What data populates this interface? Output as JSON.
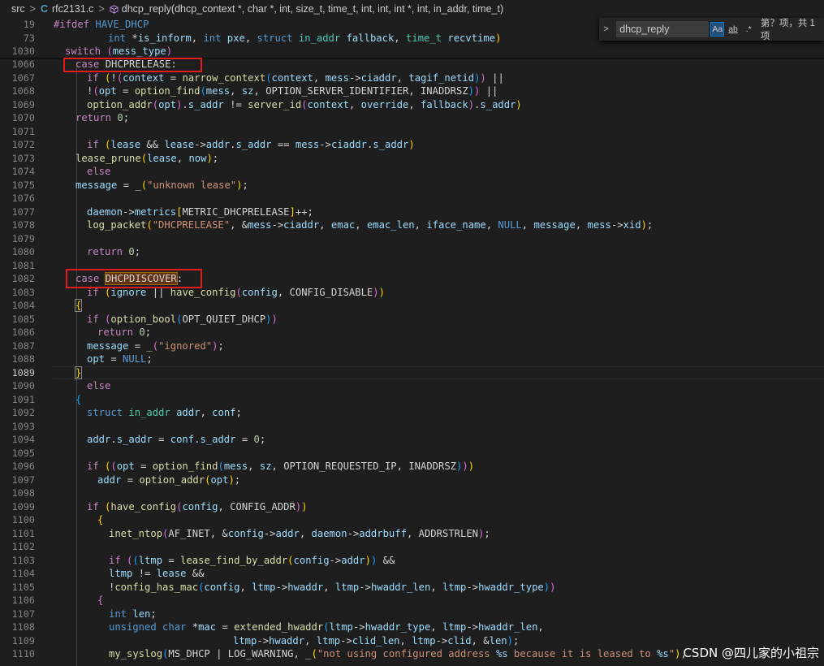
{
  "breadcrumb": {
    "folder": "src",
    "file_icon": "c-file-icon",
    "file_icon_text": "C",
    "file": "rfc2131.c",
    "symbol_icon": "method-icon",
    "symbol": "dhcp_reply(dhcp_context *, char *, int, size_t, time_t, int, int, int *, int, in_addr, time_t)"
  },
  "find": {
    "toggle_icon": "chevron-right-icon",
    "query": "dhcp_reply",
    "match_case": "Aa",
    "match_word": "ab",
    "regex": ".*",
    "result": "第？项，共 1 项"
  },
  "sticky_lines": [
    {
      "n": "19",
      "code": "#ifdef HAVE_DHCP"
    },
    {
      "n": "73",
      "code": "int *is_inform, int pxe, struct in_addr fallback, time_t recvtime)"
    },
    {
      "n": "1030",
      "code": "switch (mess_type)"
    }
  ],
  "lines": [
    {
      "n": "1066",
      "code": "case DHCPRELEASE:"
    },
    {
      "n": "1067",
      "code": "if (!(context = narrow_context(context, mess->ciaddr, tagif_netid)) ||"
    },
    {
      "n": "1068",
      "code": "!(opt = option_find(mess, sz, OPTION_SERVER_IDENTIFIER, INADDRSZ)) ||"
    },
    {
      "n": "1069",
      "code": "option_addr(opt).s_addr != server_id(context, override, fallback).s_addr)"
    },
    {
      "n": "1070",
      "code": "return 0;"
    },
    {
      "n": "1071",
      "code": ""
    },
    {
      "n": "1072",
      "code": "if (lease && lease->addr.s_addr == mess->ciaddr.s_addr)"
    },
    {
      "n": "1073",
      "code": "lease_prune(lease, now);"
    },
    {
      "n": "1074",
      "code": "else"
    },
    {
      "n": "1075",
      "code": "message = _(\"unknown lease\");"
    },
    {
      "n": "1076",
      "code": ""
    },
    {
      "n": "1077",
      "code": "daemon->metrics[METRIC_DHCPRELEASE]++;"
    },
    {
      "n": "1078",
      "code": "log_packet(\"DHCPRELEASE\", &mess->ciaddr, emac, emac_len, iface_name, NULL, message, mess->xid);"
    },
    {
      "n": "1079",
      "code": ""
    },
    {
      "n": "1080",
      "code": "return 0;"
    },
    {
      "n": "1081",
      "code": ""
    },
    {
      "n": "1082",
      "code": "case DHCPDISCOVER:"
    },
    {
      "n": "1083",
      "code": "if (ignore || have_config(config, CONFIG_DISABLE))"
    },
    {
      "n": "1084",
      "code": "{"
    },
    {
      "n": "1085",
      "code": "if (option_bool(OPT_QUIET_DHCP))"
    },
    {
      "n": "1086",
      "code": "return 0;"
    },
    {
      "n": "1087",
      "code": "message = _(\"ignored\");"
    },
    {
      "n": "1088",
      "code": "opt = NULL;"
    },
    {
      "n": "1089",
      "code": "}"
    },
    {
      "n": "1090",
      "code": "else"
    },
    {
      "n": "1091",
      "code": "{"
    },
    {
      "n": "1092",
      "code": "struct in_addr addr, conf;"
    },
    {
      "n": "1093",
      "code": ""
    },
    {
      "n": "1094",
      "code": "addr.s_addr = conf.s_addr = 0;"
    },
    {
      "n": "1095",
      "code": ""
    },
    {
      "n": "1096",
      "code": "if ((opt = option_find(mess, sz, OPTION_REQUESTED_IP, INADDRSZ)))"
    },
    {
      "n": "1097",
      "code": "addr = option_addr(opt);"
    },
    {
      "n": "1098",
      "code": ""
    },
    {
      "n": "1099",
      "code": "if (have_config(config, CONFIG_ADDR))"
    },
    {
      "n": "1100",
      "code": "{"
    },
    {
      "n": "1101",
      "code": "inet_ntop(AF_INET, &config->addr, daemon->addrbuff, ADDRSTRLEN);"
    },
    {
      "n": "1102",
      "code": ""
    },
    {
      "n": "1103",
      "code": "if ((ltmp = lease_find_by_addr(config->addr)) &&"
    },
    {
      "n": "1104",
      "code": "ltmp != lease &&"
    },
    {
      "n": "1105",
      "code": "!config_has_mac(config, ltmp->hwaddr, ltmp->hwaddr_len, ltmp->hwaddr_type))"
    },
    {
      "n": "1106",
      "code": "{"
    },
    {
      "n": "1107",
      "code": "int len;"
    },
    {
      "n": "1108",
      "code": "unsigned char *mac = extended_hwaddr(ltmp->hwaddr_type, ltmp->hwaddr_len,"
    },
    {
      "n": "1109",
      "code": "ltmp->hwaddr, ltmp->clid_len, ltmp->clid, &len);"
    },
    {
      "n": "1110",
      "code": "my_syslog(MS_DHCP | LOG_WARNING, _(\"not using configured address %s because it is leased to %s\"),"
    }
  ],
  "watermark": "CSDN @四儿家的小祖宗"
}
